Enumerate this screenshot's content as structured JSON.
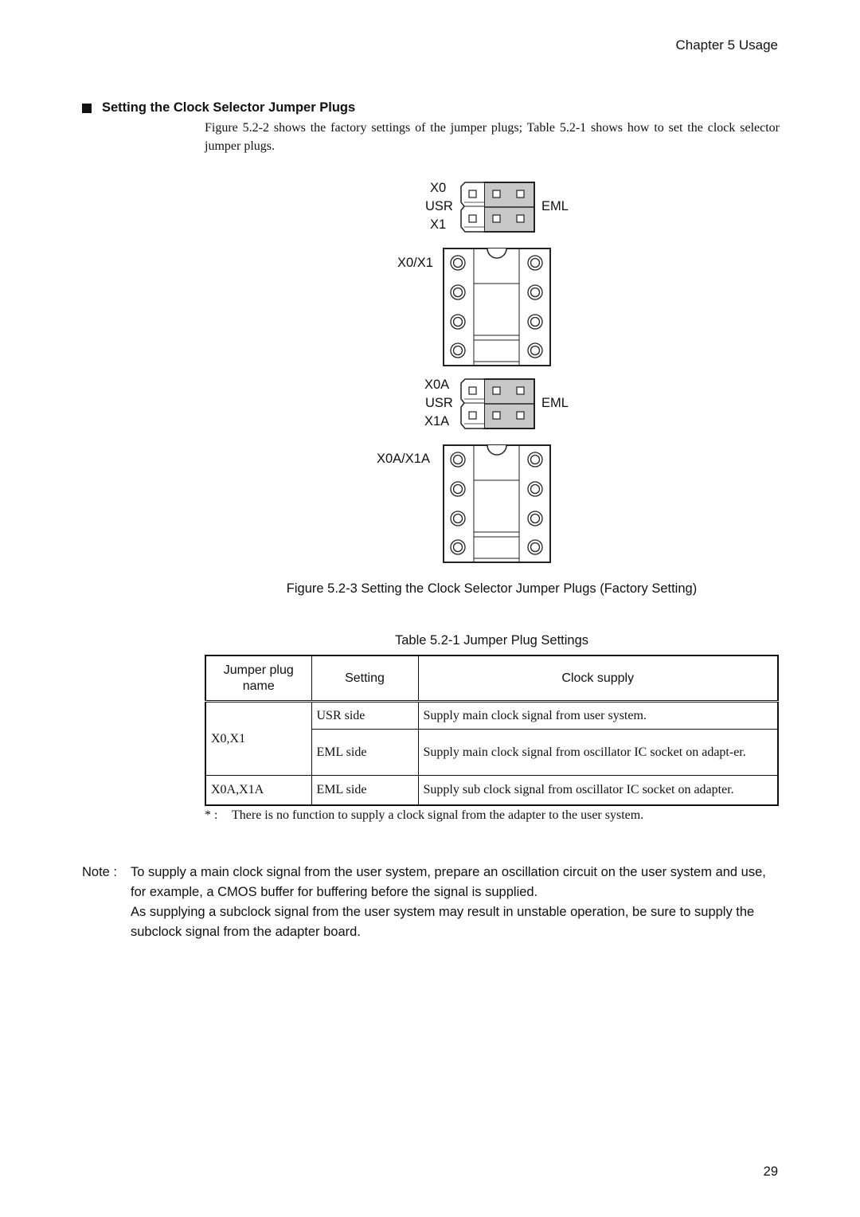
{
  "header": {
    "chapter": "Chapter 5 Usage"
  },
  "section": {
    "heading": "Setting the Clock Selector Jumper Plugs",
    "intro": "Figure 5.2-2 shows the factory settings of the jumper plugs; Table 5.2-1 shows how to set the clock selector jumper plugs."
  },
  "figure": {
    "jumper_block_1": {
      "top_label": "X0",
      "side_label": "USR",
      "bottom_label": "X1",
      "right_label": "EML"
    },
    "socket_1_label": "X0/X1",
    "jumper_block_2": {
      "top_label": "X0A",
      "side_label": "USR",
      "bottom_label": "X1A",
      "right_label": "EML"
    },
    "socket_2_label": "X0A/X1A",
    "caption": "Figure 5.2-3 Setting the Clock Selector Jumper Plugs (Factory Setting)"
  },
  "table": {
    "caption": "Table 5.2-1 Jumper Plug Settings",
    "headers": [
      "Jumper plug name",
      "Setting",
      "Clock supply"
    ],
    "rows": [
      {
        "name": "X0,X1",
        "setting": "USR side",
        "supply": "Supply main clock signal from user system."
      },
      {
        "name": "",
        "setting": "EML side",
        "supply": "Supply main clock signal from oscillator IC socket on adapt-er."
      },
      {
        "name": "X0A,X1A",
        "setting": "EML side",
        "supply": "Supply sub clock signal from oscillator IC socket on adapter."
      }
    ],
    "footnote_mark": "* :",
    "footnote": "There is no function to supply a clock signal from the adapter to the user system."
  },
  "note": {
    "label": "Note :",
    "paragraph_1": "To supply a main clock signal from the user system, prepare an oscillation circuit on the user system and use, for example, a CMOS buffer for buffering before the signal is supplied.",
    "paragraph_2": "As supplying a subclock signal from the user system may result in unstable operation, be sure to supply the subclock signal from the adapter board."
  },
  "footer": {
    "page_number": "29"
  }
}
